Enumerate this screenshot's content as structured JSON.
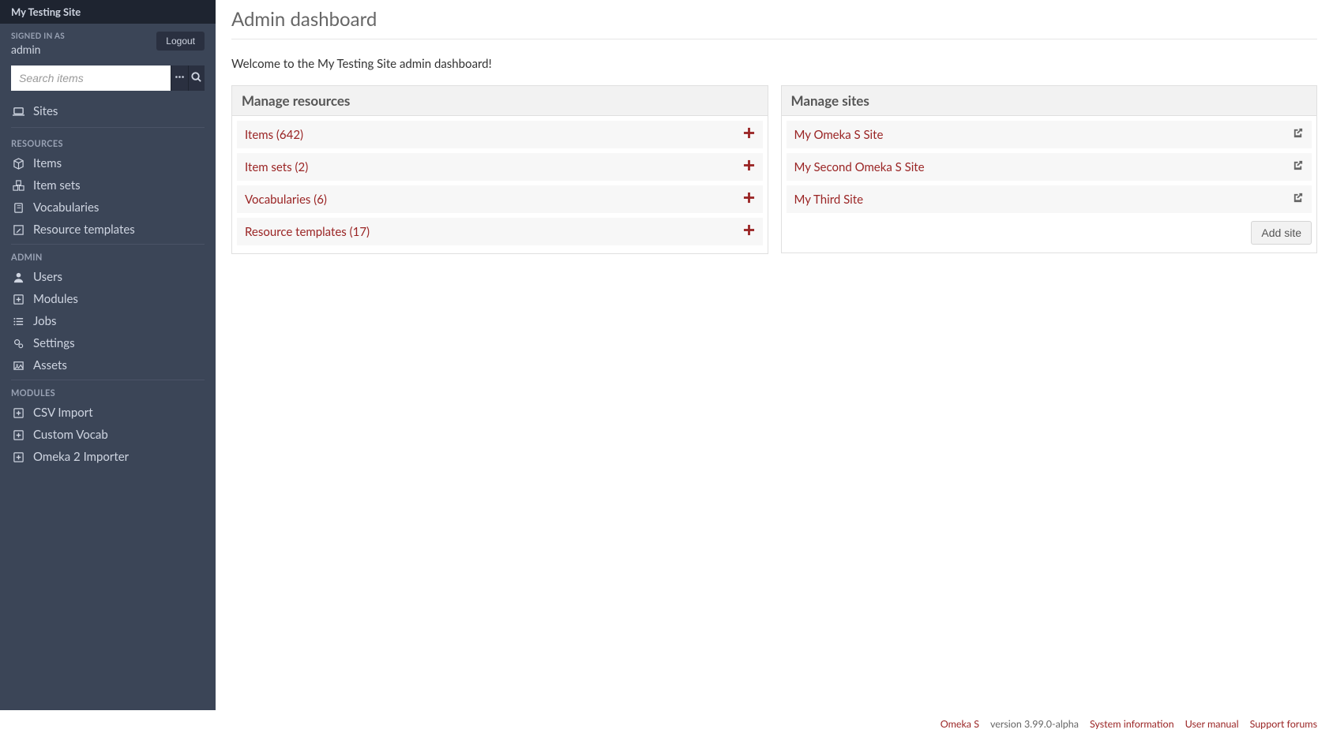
{
  "site_title": "My Testing Site",
  "signed_in_label": "SIGNED IN AS",
  "user_name": "admin",
  "logout_label": "Logout",
  "search": {
    "placeholder": "Search items"
  },
  "nav": {
    "sites_label": "Sites",
    "resources_heading": "RESOURCES",
    "resources": {
      "items": "Items",
      "item_sets": "Item sets",
      "vocabularies": "Vocabularies",
      "resource_templates": "Resource templates"
    },
    "admin_heading": "ADMIN",
    "admin": {
      "users": "Users",
      "modules": "Modules",
      "jobs": "Jobs",
      "settings": "Settings",
      "assets": "Assets"
    },
    "modules_heading": "MODULES",
    "modules_list": {
      "csv_import": "CSV Import",
      "custom_vocab": "Custom Vocab",
      "omeka2_importer": "Omeka 2 Importer"
    }
  },
  "page_title": "Admin dashboard",
  "welcome_text": "Welcome to the My Testing Site admin dashboard!",
  "manage_resources": {
    "heading": "Manage resources",
    "rows": {
      "items": "Items (642)",
      "item_sets": "Item sets (2)",
      "vocabularies": "Vocabularies (6)",
      "resource_templates": "Resource templates (17)"
    }
  },
  "manage_sites": {
    "heading": "Manage sites",
    "rows": {
      "site1": "My Omeka S Site",
      "site2": "My Second Omeka S Site",
      "site3": "My Third Site"
    },
    "add_site_label": "Add site"
  },
  "footer": {
    "brand": "Omeka S",
    "version": "version 3.99.0-alpha",
    "system_info": "System information",
    "user_manual": "User manual",
    "support_forums": "Support forums"
  }
}
